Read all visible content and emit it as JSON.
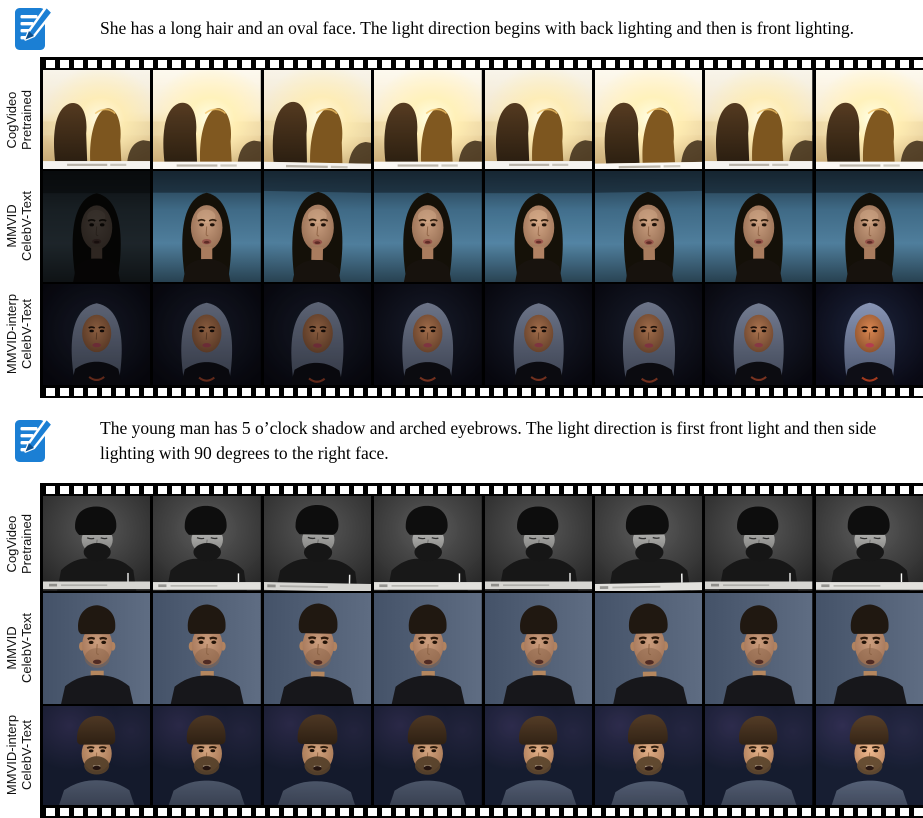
{
  "figure": {
    "type": "video-generation-comparison-figure",
    "colors": {
      "icon_blue": "#1b7fd4",
      "film_black": "#000000",
      "sprocket_white": "#ffffff",
      "text": "#000000"
    },
    "frames_per_row": 8
  },
  "prompts": [
    {
      "icon": "edit-note-icon",
      "text": "She has a long hair and an oval face. The light direction begins with back lighting and then is front lighting."
    },
    {
      "icon": "edit-note-icon",
      "text": "The young man has 5 o’clock shadow and arched eyebrows. The light direction is first front light and then side lighting with 90 degrees to the right face."
    }
  ],
  "strips": [
    {
      "name": "filmstrip-1",
      "rows": [
        {
          "label": [
            "CogVideo",
            "Pretrained"
          ],
          "variant": "backlit-couple",
          "frames": 8,
          "scene": "two long-haired figures seen from behind, backlit by bright sunset over water, white watermark bar"
        },
        {
          "label": [
            "MMVID",
            "CelebV-Text"
          ],
          "variant": "woman-blue",
          "frames": 8,
          "scene": "woman with long dark hair on blue background, first frame back-lit dark then front-lit"
        },
        {
          "label": [
            "MMVID-interp",
            "CelebV-Text"
          ],
          "variant": "woman-dark",
          "frames": 8,
          "scene": "woman with grey-blue hair on near-black background, lighting brightens toward last frame"
        }
      ]
    },
    {
      "name": "filmstrip-2",
      "rows": [
        {
          "label": [
            "CogVideo",
            "Pretrained"
          ],
          "variant": "man-bw",
          "frames": 8,
          "scene": "black-and-white bearded man looking down, grey watermark bar at bottom"
        },
        {
          "label": [
            "MMVID",
            "CelebV-Text"
          ],
          "variant": "man-blue",
          "frames": 8,
          "scene": "dark-haired man in black tee on slate blue-grey background"
        },
        {
          "label": [
            "MMVID-interp",
            "CelebV-Text"
          ],
          "variant": "man-navy",
          "frames": 8,
          "scene": "brown-haired bearded man talking on dark navy background, side light increases"
        }
      ]
    }
  ]
}
